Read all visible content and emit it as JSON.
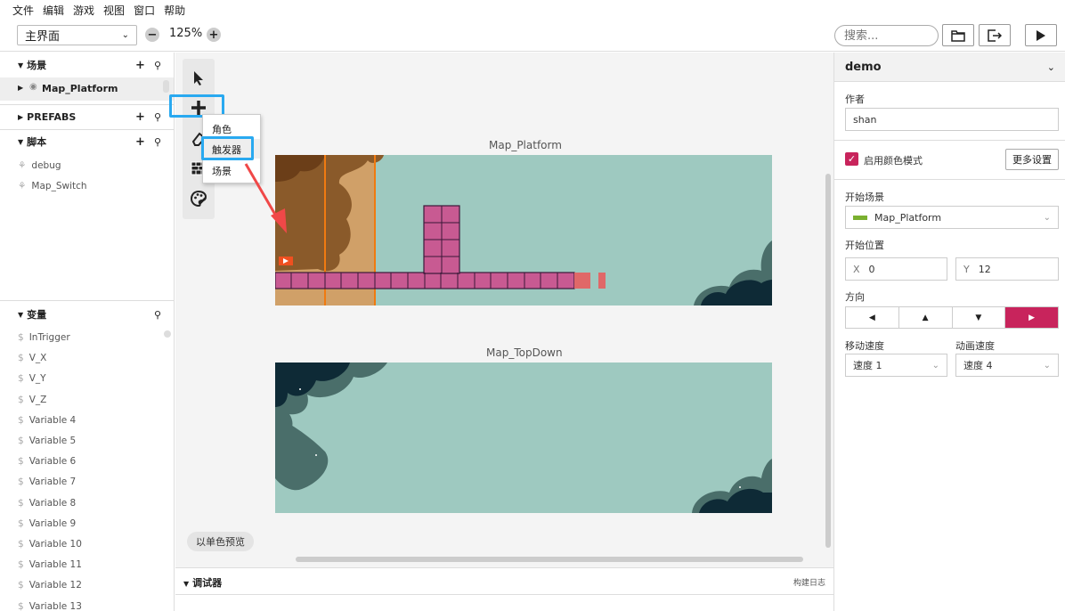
{
  "menubar": {
    "items": [
      "文件",
      "编辑",
      "游戏",
      "视图",
      "窗口",
      "帮助"
    ]
  },
  "toolbar": {
    "scene_select": "主界面",
    "zoom": "125%",
    "search_placeholder": "搜索...",
    "icons": [
      "folder-icon",
      "export-icon",
      "play-icon"
    ]
  },
  "sidebar": {
    "scenes": {
      "title": "场景",
      "items": [
        "Map_Platform"
      ]
    },
    "prefabs": {
      "title": "PREFABS"
    },
    "scripts": {
      "title": "脚本",
      "items": [
        "debug",
        "Map_Switch"
      ]
    },
    "variables": {
      "title": "变量",
      "items": [
        "InTrigger",
        "V_X",
        "V_Y",
        "V_Z",
        "Variable 4",
        "Variable 5",
        "Variable 6",
        "Variable 7",
        "Variable 8",
        "Variable 9",
        "Variable 10",
        "Variable 11",
        "Variable 12",
        "Variable 13"
      ]
    }
  },
  "palette": {
    "icons": [
      "cursor-icon",
      "add-icon",
      "eraser-icon",
      "wall-icon",
      "palette-icon"
    ],
    "add_menu": [
      "角色",
      "触发器",
      "场景"
    ],
    "add_menu_hover": "触发器"
  },
  "canvas": {
    "maps": [
      {
        "name": "Map_Platform"
      },
      {
        "name": "Map_TopDown"
      }
    ],
    "mono_preview": "以单色预览"
  },
  "debugger": {
    "title": "调试器",
    "build_log": "构建日志"
  },
  "project": {
    "name": "demo",
    "author_label": "作者",
    "author": "shan",
    "color_mode_label": "启用颜色模式",
    "color_mode": true,
    "more_settings": "更多设置",
    "start_scene_label": "开始场景",
    "start_scene": "Map_Platform",
    "start_pos_label": "开始位置",
    "x_label": "X",
    "x": "0",
    "y_label": "Y",
    "y": "12",
    "direction_label": "方向",
    "directions": [
      "◀",
      "▲",
      "▼",
      "▶"
    ],
    "direction_selected": 3,
    "move_speed_label": "移动速度",
    "move_speed": "速度 1",
    "anim_speed_label": "动画速度",
    "anim_speed": "速度 4"
  },
  "colors": {
    "accent": "#c8245c",
    "highlight": "#29a9f0",
    "map_bg": "#9ec9c0",
    "dark_cloud": "#0e2a36",
    "mid_cloud": "#4a6e6a"
  }
}
